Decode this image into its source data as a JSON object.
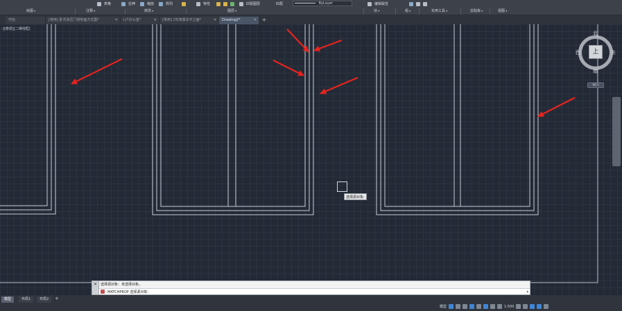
{
  "ribbon": {
    "top_items": [
      {
        "label": "表格",
        "icon": "table-icon"
      },
      {
        "label": "拉伸",
        "icon": "stretch-icon"
      },
      {
        "label": "缩放",
        "icon": "scale-icon"
      },
      {
        "label": "阵列",
        "icon": "array-icon"
      },
      {
        "label": "特性",
        "icon": "properties-icon"
      },
      {
        "label": "匹配图层",
        "icon": "match-layer-icon"
      }
    ],
    "match_label": "匹配",
    "linetype_value": "ByLayer",
    "edit_attr_label": "编辑属性",
    "panels": [
      "绘图",
      "注释",
      "修改",
      "图层",
      "块",
      "组",
      "实用工具",
      "剪贴板",
      "视图"
    ]
  },
  "file_tabs": [
    {
      "label": "开始",
      "active": false
    },
    {
      "label": "[常用] 卧式液压门侧地面方式图*",
      "active": false
    },
    {
      "label": "L户办公室*",
      "active": false
    },
    {
      "label": "[常用] 2年用版本平立面*",
      "active": false
    },
    {
      "label": "Drawing2*",
      "active": true
    }
  ],
  "viewport": {
    "label": "-][俯视][二维线框]",
    "viewcube": {
      "north": "北",
      "south": "南",
      "east": "东",
      "west": "西",
      "face": "上",
      "wcs": "WCS"
    },
    "tooltip": "选择源对象:"
  },
  "command": {
    "history": "选择源对象：未选择对象。",
    "prompt": "MATCHPROP 选择源对象：",
    "close_glyph": "✕"
  },
  "layout_tabs": [
    {
      "label": "模型",
      "active": true
    },
    {
      "label": "布局1",
      "active": false
    },
    {
      "label": "布局2",
      "active": false
    }
  ],
  "status": {
    "model": "模型",
    "scale": "1:500"
  },
  "colors": {
    "arrow": "#e8231d",
    "lines": "#c9cfd8",
    "background": "#232a36"
  }
}
